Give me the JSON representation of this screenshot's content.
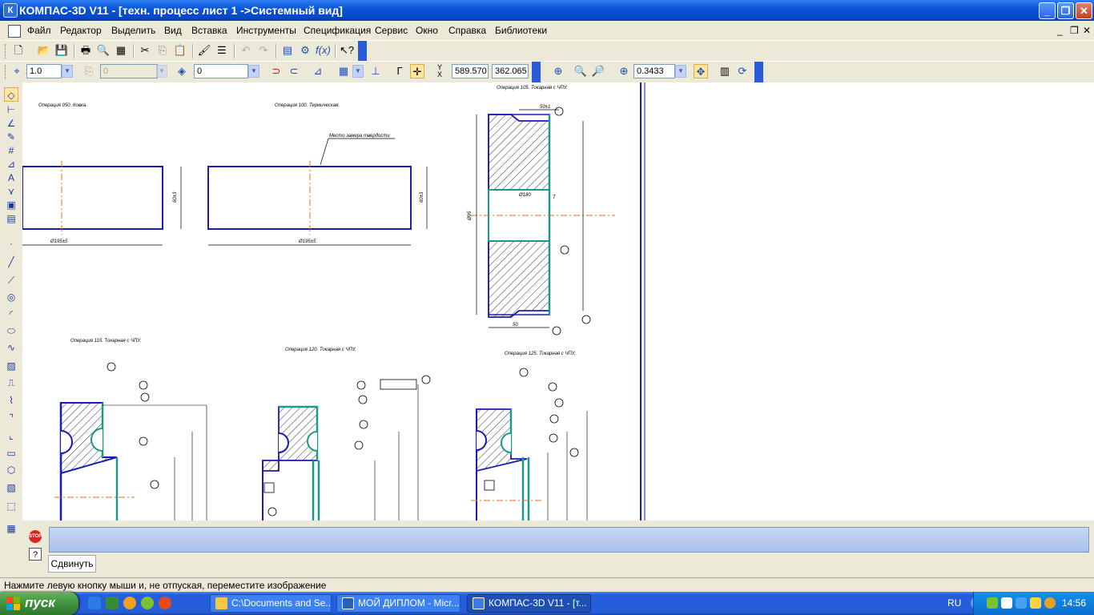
{
  "window": {
    "title": "КОМПАС-3D V11 - [техн. процесс лист 1 ->Системный вид]",
    "app_icon": "kompas-logo-icon",
    "min": "_",
    "max": "❐",
    "close": "✕"
  },
  "menu": {
    "items": [
      "Файл",
      "Редактор",
      "Выделить",
      "Вид",
      "Вставка",
      "Инструменты",
      "Спецификация",
      "Сервис",
      "Окно",
      "Справка",
      "Библиотеки"
    ],
    "mdi_min": "_",
    "mdi_restore": "❐",
    "mdi_close": "✕"
  },
  "toolbar2": {
    "line_scale": "1.0",
    "layer_disabled": "0",
    "layer_value": "0",
    "coord_x": "589.570",
    "coord_y": "362.065",
    "zoom": "0.3433"
  },
  "drawing": {
    "op1": "Операция 050. Ковка.",
    "op2": "Операция 100. Термическая.",
    "op3": "Операция 105. Токарная с ЧПУ.",
    "op4": "Операция 115. Токарная с ЧПУ.",
    "op5": "Операция 120. Токарная с ЧПУ.",
    "op6": "Операция 125. Токарная с ЧПУ.",
    "hardness_note": "Место замера твердости",
    "dim_60a": "60±3",
    "dim_60b": "60±3",
    "dim_195a": "Ø195±5",
    "dim_195b": "Ø195±5",
    "dim_50x1": "50±1",
    "dim_d95": "Ø95",
    "dim_d80": "Ø180",
    "dim_t": "Т",
    "dim_50": "50"
  },
  "command_panel": {
    "tab_label": "Сдвинуть",
    "stop_label": "STOP",
    "help_label": "?"
  },
  "status": {
    "text": "Нажмите левую кнопку мыши и, не отпуская, переместите изображение"
  },
  "taskbar": {
    "start": "пуск",
    "buttons": [
      "C:\\Documents and Se...",
      "МОЙ ДИПЛОМ - Micr...",
      "КОМПАС-3D V11 - [т..."
    ],
    "lang": "RU",
    "clock": "14:56"
  }
}
